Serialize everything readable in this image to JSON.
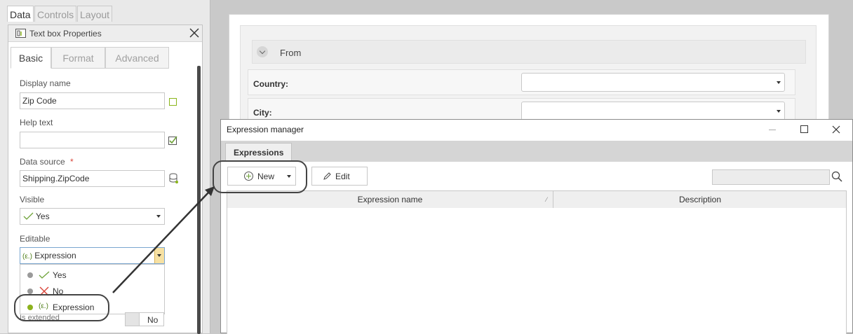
{
  "left_panel": {
    "top_tabs": [
      "Data",
      "Controls",
      "Layout"
    ],
    "properties": {
      "title": "Text box Properties",
      "tabs": [
        "Basic",
        "Format",
        "Advanced"
      ],
      "display_name": {
        "label": "Display name",
        "value": "Zip Code"
      },
      "help_text": {
        "label": "Help text",
        "value": ""
      },
      "data_source": {
        "label": "Data source",
        "required_mark": "*",
        "value": "Shipping.ZipCode"
      },
      "visible": {
        "label": "Visible",
        "value": "Yes"
      },
      "editable": {
        "label": "Editable",
        "value": "Expression",
        "icon_text": "(ε.)",
        "options": [
          "Yes",
          "No",
          "Expression"
        ],
        "option_icon_text": "(ε.)"
      },
      "is_extended": {
        "label": "Is extended",
        "toggle_value": "No"
      }
    }
  },
  "form": {
    "section_title": "From",
    "rows": [
      {
        "label": "Country:"
      },
      {
        "label": "City:"
      }
    ]
  },
  "expression_manager": {
    "title": "Expression manager",
    "tab": "Expressions",
    "new_label": "New",
    "edit_label": "Edit",
    "columns": [
      "Expression name",
      "Description"
    ]
  },
  "colors": {
    "accent_green": "#8ab51a",
    "check_green": "#6fa33a",
    "x_red": "#d9463b",
    "dot_grey": "#9a9a9a",
    "dot_green": "#8cb21d"
  }
}
